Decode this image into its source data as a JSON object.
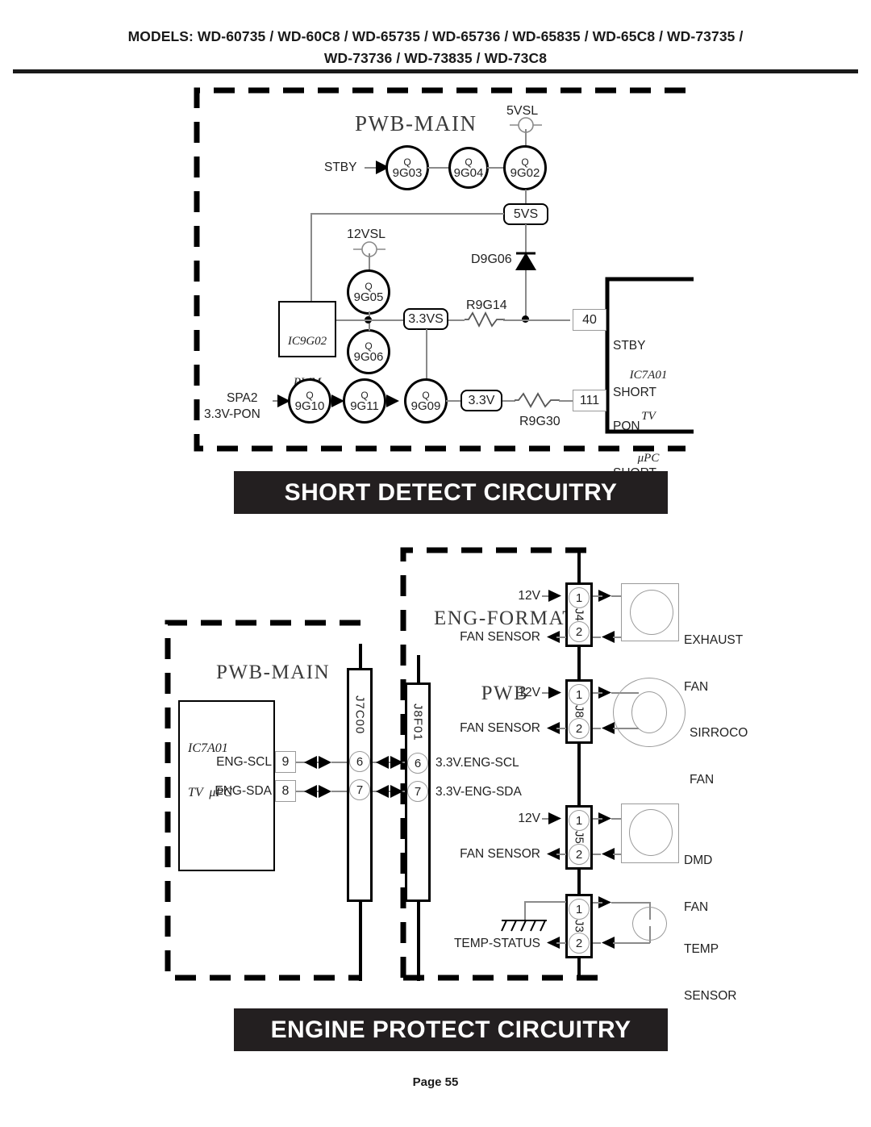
{
  "header": {
    "models_line1": "MODELS: WD-60735 / WD-60C8 / WD-65735 / WD-65736 / WD-65835 / WD-65C8 / WD-73735 /",
    "models_line2": "WD-73736 / WD-73835 / WD-73C8"
  },
  "page_footer": {
    "page_label": "Page 55"
  },
  "banners": {
    "short_detect": "SHORT DETECT CIRCUITRY",
    "engine_protect": "ENGINE PROTECT CIRCUITRY"
  },
  "short_detect": {
    "board_title": "PWB-MAIN",
    "supply_5vsl": "5VSL",
    "supply_12vsl": "12VSL",
    "input_stby": "STBY",
    "input_spa2": "SPA2",
    "input_pon": "3.3V-PON",
    "transistors": [
      {
        "type": "Q",
        "ref": "9G03"
      },
      {
        "type": "Q",
        "ref": "9G04"
      },
      {
        "type": "Q",
        "ref": "9G02"
      },
      {
        "type": "Q",
        "ref": "9G05"
      },
      {
        "type": "Q",
        "ref": "9G06"
      },
      {
        "type": "Q",
        "ref": "9G10"
      },
      {
        "type": "Q",
        "ref": "9G11"
      },
      {
        "type": "Q",
        "ref": "9G09"
      }
    ],
    "net_5vs": "5VS",
    "net_33vs": "3.3VS",
    "net_33v": "3.3V",
    "diode_ref": "D9G06",
    "resistor_top": "R9G14",
    "resistor_bottom": "R9G30",
    "pwm_ic_line1": "IC9G02",
    "pwm_ic_line2": "PWM",
    "tv_ic_line1": "IC7A01",
    "tv_ic_line2": "TV",
    "tv_ic_line3": "μPC",
    "pin_40": "40",
    "pin_40_label_line1": "STBY",
    "pin_40_label_line2": "SHORT",
    "pin_111": "111",
    "pin_111_label_line1": "PON",
    "pin_111_label_line2": "SHORT"
  },
  "engine_protect": {
    "main_board_title": "PWB-MAIN",
    "eng_board_title_line1": "ENG-FORMAT",
    "eng_board_title_line2": "PWB",
    "tv_ic_line1": "IC7A01",
    "tv_ic_line2": "TV  μPC",
    "signals": [
      {
        "name": "ENG-SCL",
        "ic_pin": "9",
        "j7_pin": "6",
        "j8_pin": "6",
        "far_label": "3.3V.ENG-SCL"
      },
      {
        "name": "ENG-SDA",
        "ic_pin": "8",
        "j7_pin": "7",
        "j8_pin": "7",
        "far_label": "3.3V-ENG-SDA"
      }
    ],
    "connector_j7": "J7C00",
    "connector_j8": "J8F01",
    "devices": [
      {
        "connector": "J4",
        "pin1": "1",
        "pin2": "2",
        "pin1_label": "12V",
        "pin2_label": "FAN SENSOR",
        "device_line1": "EXHAUST",
        "device_line2": "FAN",
        "shape": "box-circle"
      },
      {
        "connector": "J8",
        "pin1": "1",
        "pin2": "2",
        "pin1_label": "12V",
        "pin2_label": "FAN SENSOR",
        "device_line1": "SIRROCO",
        "device_line2": "FAN",
        "shape": "double-circle"
      },
      {
        "connector": "J5",
        "pin1": "1",
        "pin2": "2",
        "pin1_label": "12V",
        "pin2_label": "FAN SENSOR",
        "device_line1": "DMD",
        "device_line2": "FAN",
        "shape": "box-circle"
      },
      {
        "connector": "J3",
        "pin1": "1",
        "pin2": "2",
        "pin1_label": "",
        "pin2_label": "TEMP-STATUS",
        "device_line1": "TEMP",
        "device_line2": "SENSOR",
        "shape": "small-circle"
      }
    ]
  },
  "colors": {
    "ink": "#231f20",
    "wire": "#8a8a8a",
    "banner_bg": "#231f20",
    "banner_fg": "#ffffff"
  }
}
